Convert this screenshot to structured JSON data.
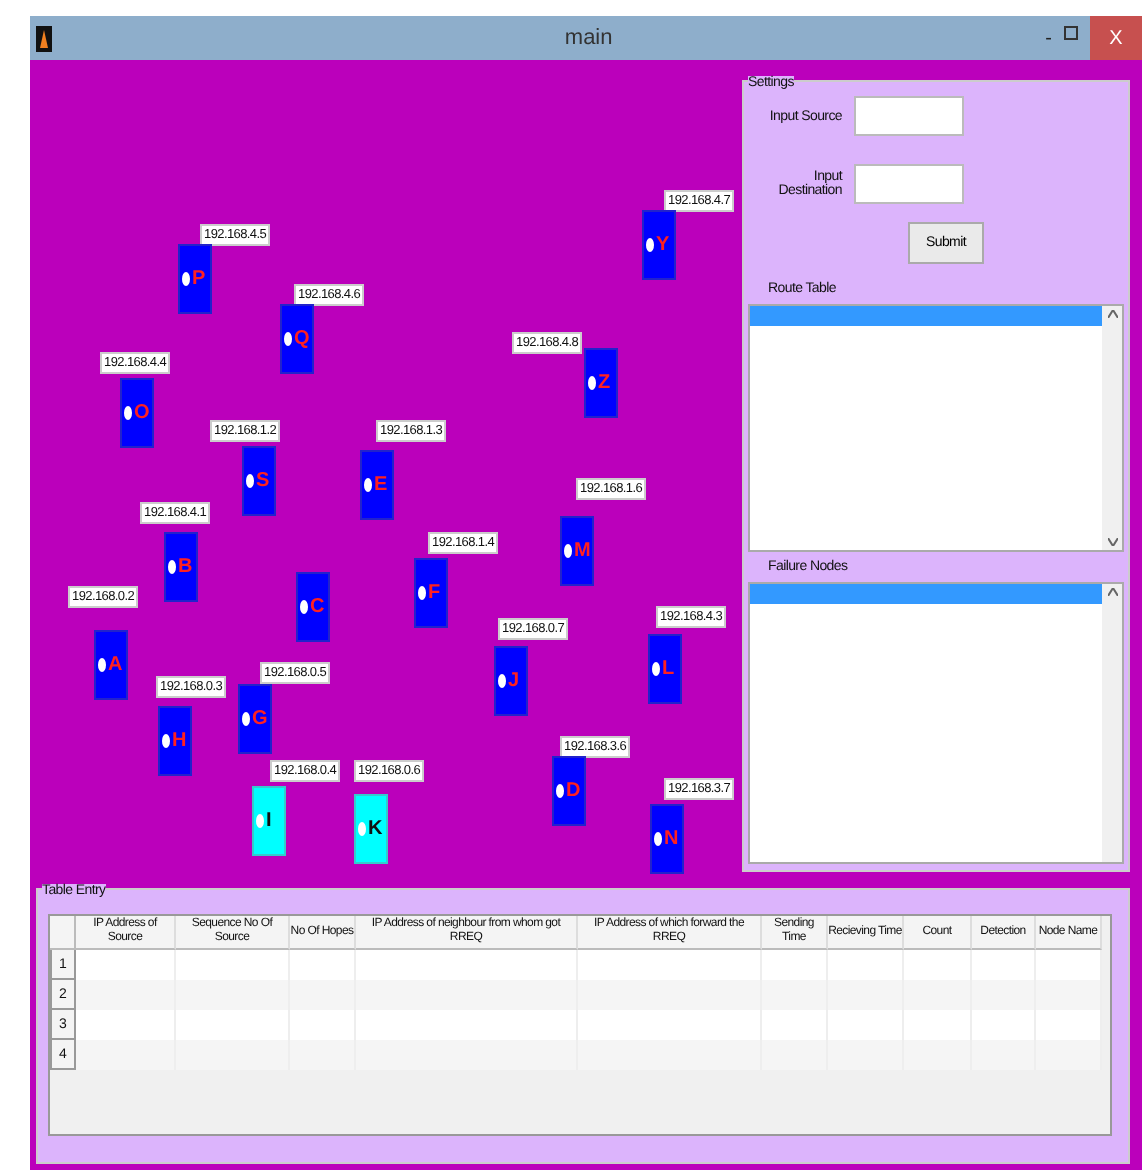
{
  "window": {
    "title": "main",
    "minimize_label": "-",
    "close_label": "X"
  },
  "nodes": [
    {
      "letter": "P",
      "ip": "192.168.4.5",
      "highlighted": false
    },
    {
      "letter": "Q",
      "ip": "192.168.4.6",
      "highlighted": false
    },
    {
      "letter": "O",
      "ip": "192.168.4.4",
      "highlighted": false
    },
    {
      "letter": "S",
      "ip": "192.168.1.2",
      "highlighted": false
    },
    {
      "letter": "E",
      "ip": "192.168.1.3",
      "highlighted": false
    },
    {
      "letter": "Y",
      "ip": "192.168.4.7",
      "highlighted": false
    },
    {
      "letter": "Z",
      "ip": "192.168.4.8",
      "highlighted": false
    },
    {
      "letter": "M",
      "ip": "192.168.1.6",
      "highlighted": false
    },
    {
      "letter": "B",
      "ip": "192.168.4.1",
      "highlighted": false
    },
    {
      "letter": "C",
      "highlighted": false
    },
    {
      "letter": "F",
      "ip": "192.168.1.4",
      "highlighted": false
    },
    {
      "letter": "A",
      "ip": "192.168.0.2",
      "highlighted": false
    },
    {
      "letter": "J",
      "ip": "192.168.0.7",
      "highlighted": false
    },
    {
      "letter": "L",
      "ip": "192.168.4.3",
      "highlighted": false
    },
    {
      "letter": "H",
      "ip": "192.168.0.3",
      "highlighted": false
    },
    {
      "letter": "G",
      "ip": "192.168.0.5",
      "highlighted": false
    },
    {
      "letter": "I",
      "ip": "192.168.0.4",
      "highlighted": true
    },
    {
      "letter": "K",
      "ip": "192.168.0.6",
      "highlighted": true
    },
    {
      "letter": "D",
      "ip": "192.168.3.6",
      "highlighted": false
    },
    {
      "letter": "N",
      "ip": "192.168.3.7",
      "highlighted": false
    }
  ],
  "settings": {
    "title": "Settings",
    "source_label": "Input Source",
    "destination_label": "Input Destination",
    "submit": "Submit",
    "route_table_label": "Route Table",
    "failure_nodes_label": "Failure Nodes"
  },
  "table_entry": {
    "title": "Table Entry",
    "columns": [
      "IP Address of Source",
      "Sequence No Of Source",
      "No Of Hopes",
      "IP Address of  neighbour from whom got RREQ",
      "IP Address of which forward the RREQ",
      "Sending Time",
      "Recieving Time",
      "Count",
      "Detection",
      "Node Name"
    ],
    "rows": [
      {
        "number": "1"
      },
      {
        "number": "2"
      },
      {
        "number": "3"
      },
      {
        "number": "4"
      }
    ]
  }
}
